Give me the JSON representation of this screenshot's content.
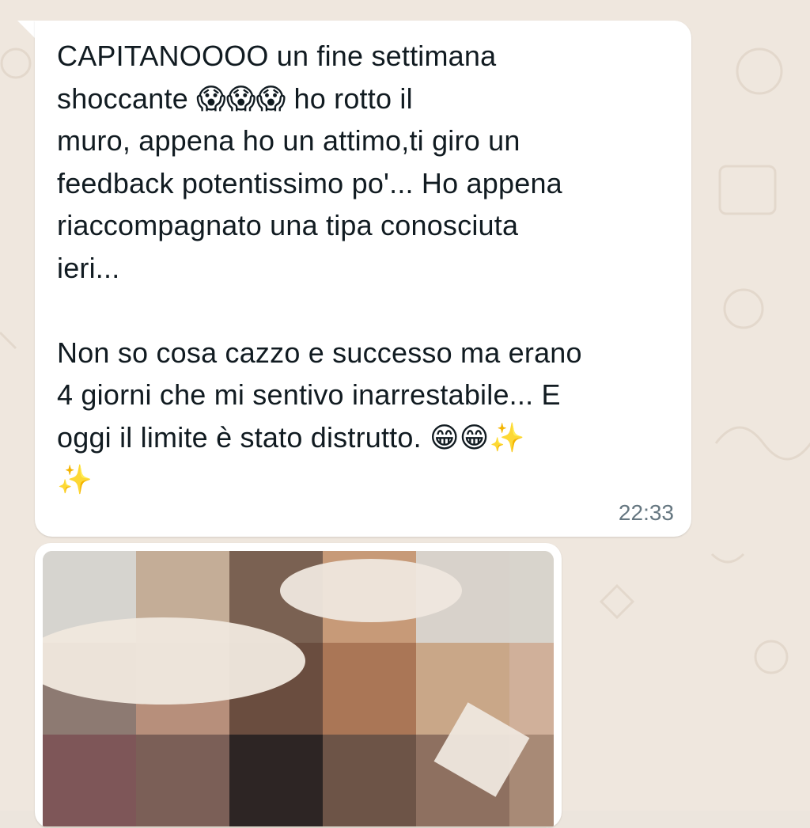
{
  "message": {
    "text": "CAPITANOOOO un fine settimana\nshoccante 😱😱😱 ho rotto il\nmuro, appena ho un attimo,ti giro un\nfeedback potentissimo po'... Ho appena\nriaccompagnato una tipa conosciuta\nieri...\n\nNon so cosa cazzo e successo ma erano\n4 giorni che mi sentivo inarrestabile... E\noggi il limite è stato distrutto. 😁😁✨\n✨",
    "time": "22:33"
  },
  "media": {
    "kind": "image",
    "pixelated": true
  },
  "colors": {
    "chat_background": "#efe7de",
    "bubble": "#ffffff",
    "text": "#111b21",
    "timestamp": "#667781"
  }
}
